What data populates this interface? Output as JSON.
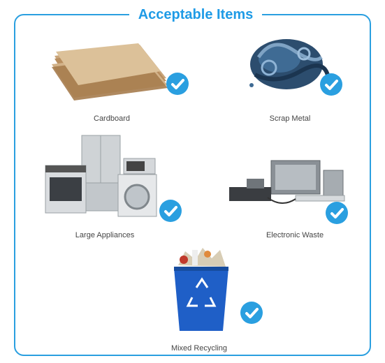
{
  "header": {
    "title": "Acceptable Items"
  },
  "items": [
    {
      "label": "Cardboard",
      "image": "cardboard-stack",
      "checked": true
    },
    {
      "label": "Scrap Metal",
      "image": "scrap-metal-pile",
      "checked": true
    },
    {
      "label": "Large Appliances",
      "image": "appliances-group",
      "checked": true
    },
    {
      "label": "Electronic Waste",
      "image": "electronics-group",
      "checked": true
    },
    {
      "label": "Mixed Recycling",
      "image": "recycling-bin",
      "checked": true
    }
  ],
  "colors": {
    "accent": "#2a9fe0",
    "title": "#1f9be6",
    "bin": "#1f5fc7"
  },
  "icons": {
    "check": "check-circle-icon",
    "recycle": "recycle-icon"
  }
}
